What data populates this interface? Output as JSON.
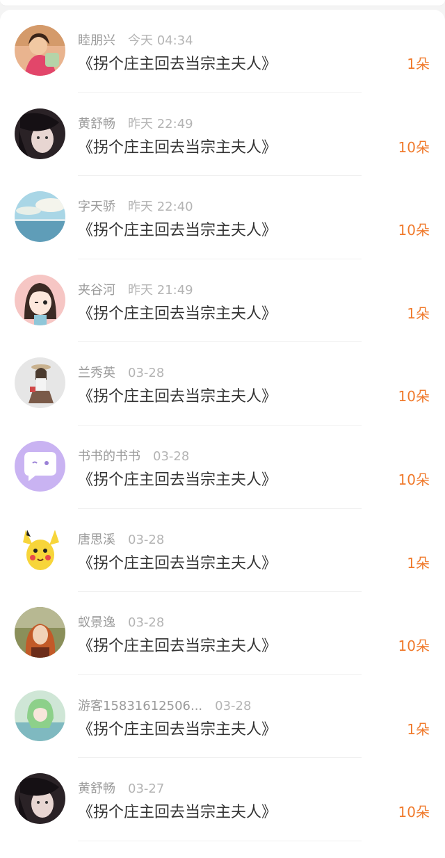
{
  "colors": {
    "accent": "#f07a2c",
    "name": "#9b9b9b",
    "title": "#333333"
  },
  "gifts": [
    {
      "name": "睦朋兴",
      "time": "今天 04:34",
      "title": "《拐个庄主回去当宗主夫人》",
      "count": "1朵",
      "avatar_icon": "girl-photo-avatar"
    },
    {
      "name": "黄舒畅",
      "time": "昨天 22:49",
      "title": "《拐个庄主回去当宗主夫人》",
      "count": "10朵",
      "avatar_icon": "dark-hair-photo-avatar"
    },
    {
      "name": "字天骄",
      "time": "昨天 22:40",
      "title": "《拐个庄主回去当宗主夫人》",
      "count": "10朵",
      "avatar_icon": "seascape-avatar"
    },
    {
      "name": "夹谷河",
      "time": "昨天 21:49",
      "title": "《拐个庄主回去当宗主夫人》",
      "count": "1朵",
      "avatar_icon": "cartoon-girl-avatar"
    },
    {
      "name": "兰秀英",
      "time": "03-28",
      "title": "《拐个庄主回去当宗主夫人》",
      "count": "10朵",
      "avatar_icon": "illustration-girl-avatar"
    },
    {
      "name": "书书的书书",
      "time": "03-28",
      "title": "《拐个庄主回去当宗主夫人》",
      "count": "10朵",
      "avatar_icon": "chat-bubble-avatar"
    },
    {
      "name": "唐思溪",
      "time": "03-28",
      "title": "《拐个庄主回去当宗主夫人》",
      "count": "1朵",
      "avatar_icon": "pikachu-avatar"
    },
    {
      "name": "蚁景逸",
      "time": "03-28",
      "title": "《拐个庄主回去当宗主夫人》",
      "count": "10朵",
      "avatar_icon": "red-hair-photo-avatar"
    },
    {
      "name": "游客15831612506...",
      "time": "03-28",
      "title": "《拐个庄主回去当宗主夫人》",
      "count": "1朵",
      "avatar_icon": "anime-green-avatar"
    },
    {
      "name": "黄舒畅",
      "time": "03-27",
      "title": "《拐个庄主回去当宗主夫人》",
      "count": "10朵",
      "avatar_icon": "dark-hair-photo-avatar"
    }
  ]
}
